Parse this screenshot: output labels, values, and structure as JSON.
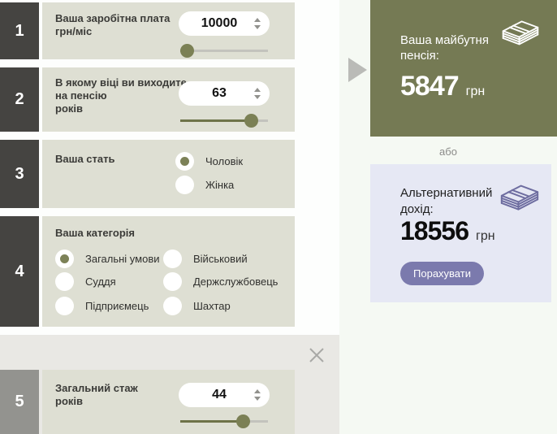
{
  "colors": {
    "accent_olive": "#7b8055",
    "card_green": "#757a54",
    "card_lavender": "#e6e8f4",
    "button_purple": "#7b7aad",
    "step_block_dark": "#454441",
    "step_block_gray": "#93938f",
    "panel_bg": "#dedfd3"
  },
  "icons": {
    "money": "banknotes-icon",
    "close": "close-icon",
    "arrow": "arrow-right-icon",
    "spinner_up": "chevron-up-icon",
    "spinner_down": "chevron-down-icon"
  },
  "sections": [
    {
      "num": "1",
      "label_lines": [
        "Ваша заробітна плата",
        "грн/міс"
      ],
      "value": "10000",
      "slider_percent": 7
    },
    {
      "num": "2",
      "label_lines": [
        "В якому віці ви виходите",
        "на пенсію",
        "років"
      ],
      "value": "63",
      "slider_percent": 81
    },
    {
      "num": "3",
      "label": "Ваша стать",
      "options": [
        {
          "label": "Чоловік",
          "selected": true
        },
        {
          "label": "Жінка",
          "selected": false
        }
      ]
    },
    {
      "num": "4",
      "label": "Ваша категорія",
      "options": [
        {
          "label": "Загальні умови",
          "selected": true
        },
        {
          "label": "Військовий",
          "selected": false
        },
        {
          "label": "Суддя",
          "selected": false
        },
        {
          "label": "Держслужбовець",
          "selected": false
        },
        {
          "label": "Підприємець",
          "selected": false
        },
        {
          "label": "Шахтар",
          "selected": false
        }
      ]
    },
    {
      "num": "5",
      "label_lines": [
        "Загальний стаж",
        "років"
      ],
      "value": "44",
      "slider_percent": 71
    }
  ],
  "result_card": {
    "title_lines": [
      "Ваша майбутня",
      "пенсія:"
    ],
    "value": "5847",
    "currency": "грн"
  },
  "separator_label": "або",
  "alt_card": {
    "title_lines": [
      "Альтернативний",
      "дохід:"
    ],
    "value": "18556",
    "currency": "грн",
    "button_label": "Порахувати"
  }
}
